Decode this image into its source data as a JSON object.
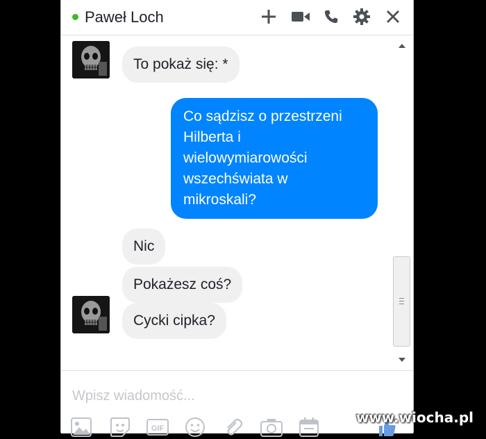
{
  "header": {
    "contact_name": "Paweł Loch",
    "status": "online",
    "icons": [
      "plus-icon",
      "video-camera-icon",
      "phone-icon",
      "gear-icon",
      "close-icon"
    ]
  },
  "messages": [
    {
      "side": "incoming",
      "text": "To pokaż się: *"
    },
    {
      "side": "outgoing",
      "text": "Co sądzisz o przestrzeni\nHilberta i\nwielowymiarowości\nwszechświata w\nmikroskali?"
    },
    {
      "side": "incoming",
      "text": "Nic"
    },
    {
      "side": "incoming",
      "text": "Pokażesz coś?"
    },
    {
      "side": "incoming",
      "text": "Cycki cipka?"
    }
  ],
  "composer": {
    "placeholder": "Wpisz wiadomość...",
    "tools": [
      "image-icon",
      "sticker-icon",
      "gif-icon",
      "emoji-icon",
      "attachment-icon",
      "camera-icon",
      "calendar-icon",
      "like-icon"
    ]
  },
  "watermark": "www.wiocha.pl",
  "colors": {
    "outgoing_bubble": "#0084ff",
    "incoming_bubble": "#f1f0f0",
    "online": "#42b72a"
  }
}
